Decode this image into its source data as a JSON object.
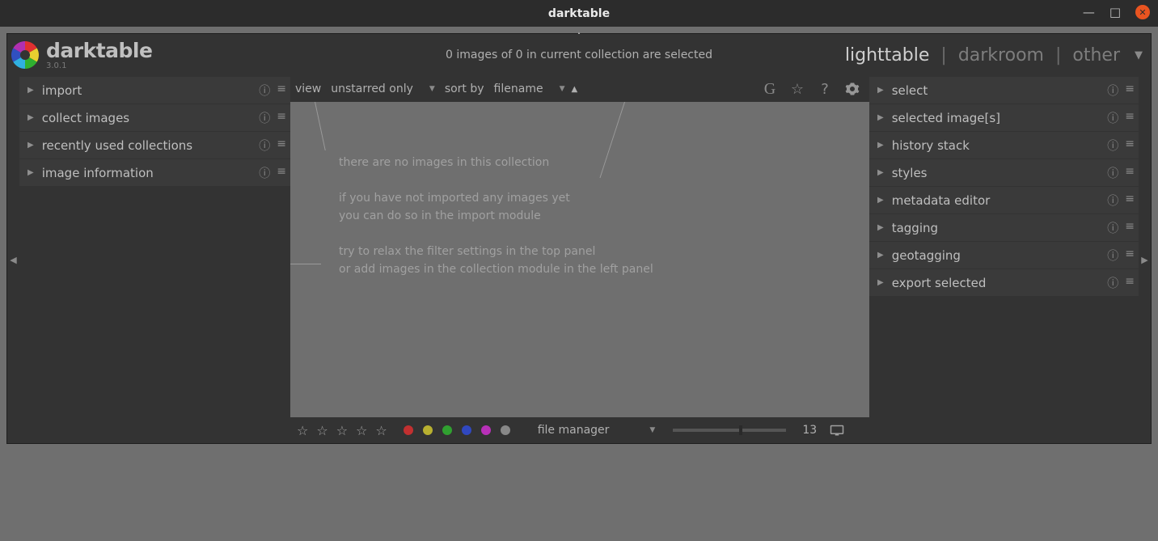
{
  "window": {
    "title": "darktable"
  },
  "brand": {
    "name": "darktable",
    "version": "3.0.1"
  },
  "header": {
    "status": "0 images of 0 in current collection are selected"
  },
  "views": {
    "lighttable": "lighttable",
    "darkroom": "darkroom",
    "other": "other",
    "active": "lighttable"
  },
  "left_modules": [
    {
      "label": "import"
    },
    {
      "label": "collect images"
    },
    {
      "label": "recently used collections"
    },
    {
      "label": "image information"
    }
  ],
  "right_modules": [
    {
      "label": "select"
    },
    {
      "label": "selected image[s]"
    },
    {
      "label": "history stack"
    },
    {
      "label": "styles"
    },
    {
      "label": "metadata editor"
    },
    {
      "label": "tagging"
    },
    {
      "label": "geotagging"
    },
    {
      "label": "export selected"
    }
  ],
  "toolbar": {
    "view_label": "view",
    "view_value": "unstarred only",
    "sort_label": "sort by",
    "sort_value": "filename"
  },
  "canvas": {
    "line1": "there are no images in this collection",
    "line2a": "if you have not imported any images yet",
    "line2b": "you can do so in the import module",
    "line3a": "try to relax the filter settings in the top panel",
    "line3b": "or add images in the collection module in the left panel"
  },
  "bottombar": {
    "layout_value": "file manager",
    "zoom_value": "13"
  },
  "color_labels": [
    "#c23030",
    "#b8b030",
    "#30a030",
    "#3048c0",
    "#b830b8",
    "#888888"
  ]
}
